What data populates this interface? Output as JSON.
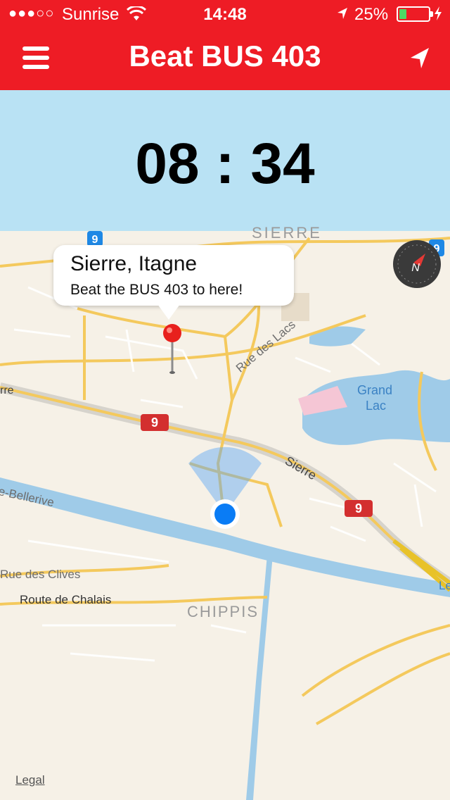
{
  "status_bar": {
    "signal": "●●●○○",
    "carrier": "Sunrise",
    "time": "14:48",
    "battery_percent": "25%",
    "battery_level": 0.25,
    "icons": [
      "wifi-icon",
      "location-arrow-icon",
      "battery-icon",
      "charging-bolt-icon"
    ]
  },
  "nav": {
    "title": "Beat BUS 403",
    "left_icon": "hamburger-menu-icon",
    "right_icon": "location-arrow-icon"
  },
  "timer": {
    "value": "08 : 34",
    "background": "#b9e2f4"
  },
  "map": {
    "callout": {
      "title": "Sierre, Itagne",
      "subtitle": "Beat the BUS 403 to here!"
    },
    "labels": {
      "sierre_top": "SIERRE",
      "rue_des_lacs": "Rue des Lacs",
      "grand": "Grand",
      "lac": "Lac",
      "sierre_road": "Sierre",
      "sierre_left": "rre",
      "bellerive": "e-Bellerive",
      "rue_des_clives": "Rue des Clives",
      "route_de_chalais": "Route de Chalais",
      "chippis": "CHIPPIS",
      "le": "Le"
    },
    "route_shields": [
      "9",
      "9",
      "9",
      "9"
    ],
    "compass_letter": "N",
    "legal": "Legal"
  },
  "colors": {
    "accent": "#ee1c25",
    "map_background": "#f6f1e7",
    "water": "#9fcbe8",
    "road": "#f4c95d",
    "user_dot": "#0a7cf5"
  }
}
